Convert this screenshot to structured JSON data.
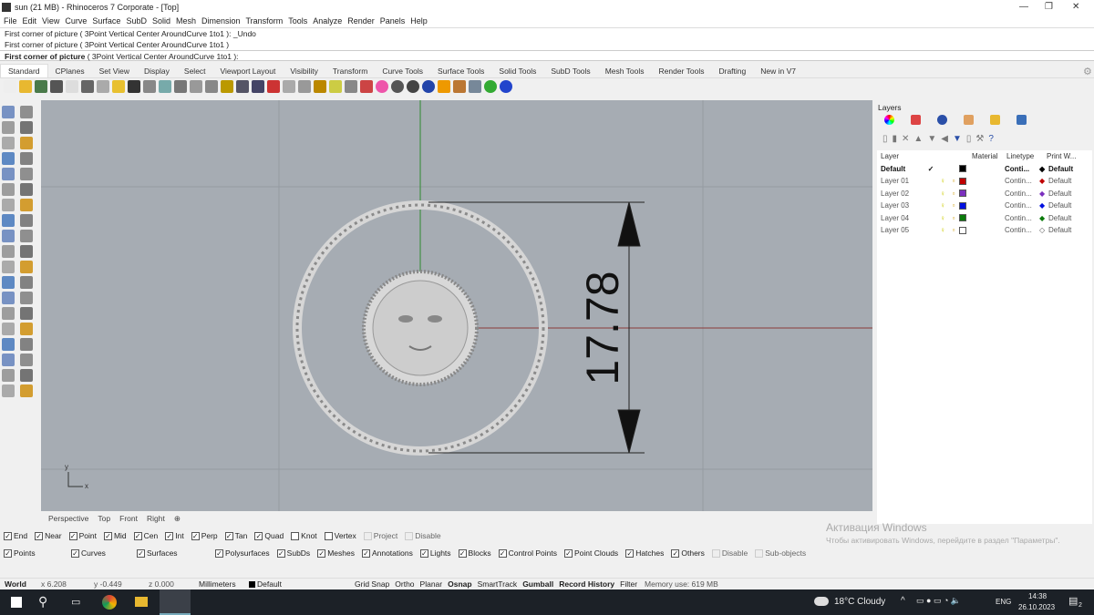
{
  "window": {
    "title": "sun (21 MB) - Rhinoceros 7 Corporate - [Top]"
  },
  "menu": [
    "File",
    "Edit",
    "View",
    "Curve",
    "Surface",
    "SubD",
    "Solid",
    "Mesh",
    "Dimension",
    "Transform",
    "Tools",
    "Analyze",
    "Render",
    "Panels",
    "Help"
  ],
  "command_history": [
    "First corner of picture ( 3Point  Vertical  Center  AroundCurve  1to1 ): _Undo",
    "First corner of picture ( 3Point  Vertical  Center  AroundCurve  1to1 )"
  ],
  "command_prompt": {
    "label": "First corner of picture",
    "options": "( 3Point  Vertical  Center  AroundCurve  1to1 ):"
  },
  "toolbar_tabs": [
    "Standard",
    "CPlanes",
    "Set View",
    "Display",
    "Select",
    "Viewport Layout",
    "Visibility",
    "Transform",
    "Curve Tools",
    "Surface Tools",
    "Solid Tools",
    "SubD Tools",
    "Mesh Tools",
    "Render Tools",
    "Drafting",
    "New in V7"
  ],
  "toolbar_icons": [
    "new-icon",
    "open-icon",
    "save-icon",
    "print-icon",
    "import-icon",
    "cut-icon",
    "copy-icon",
    "paste-icon",
    "undo-icon",
    "pan-icon",
    "rotate-view-icon",
    "zoom-icon",
    "zoom-window-icon",
    "zoom-extents-icon",
    "zoom-selected-icon",
    "undo-view-icon",
    "viewport-layout-icon",
    "car-icon",
    "hide-icon",
    "object-snap-icon",
    "point-icon",
    "light-icon",
    "lock-icon",
    "layer-icon",
    "color-wheel-icon",
    "shaded-icon",
    "rendered-icon",
    "sphere-render-icon",
    "filter-icon",
    "settings-gear-icon",
    "grid-icon",
    "globe-icon",
    "help-icon"
  ],
  "viewport": {
    "dimension_text": "17.78",
    "axis_y": "y",
    "axis_x": "x",
    "bg": "#a6acb3"
  },
  "viewport_tabs": [
    "Perspective",
    "Top",
    "Front",
    "Right"
  ],
  "layers": {
    "title": "Layers",
    "columns": [
      "Layer",
      "Material",
      "Linetype",
      "Print W..."
    ],
    "rows": [
      {
        "name": "Default",
        "linetype": "Conti...",
        "print": "Default",
        "color": "#000000",
        "current": true
      },
      {
        "name": "Layer 01",
        "linetype": "Contin...",
        "print": "Default",
        "color": "#c00000"
      },
      {
        "name": "Layer 02",
        "linetype": "Contin...",
        "print": "Default",
        "color": "#7b2fbe"
      },
      {
        "name": "Layer 03",
        "linetype": "Contin...",
        "print": "Default",
        "color": "#0010e0"
      },
      {
        "name": "Layer 04",
        "linetype": "Contin...",
        "print": "Default",
        "color": "#0a7a0a"
      },
      {
        "name": "Layer 05",
        "linetype": "Contin...",
        "print": "Default",
        "color": "#ffffff"
      }
    ]
  },
  "osnaps": [
    {
      "l": "End",
      "c": true
    },
    {
      "l": "Near",
      "c": true
    },
    {
      "l": "Point",
      "c": true
    },
    {
      "l": "Mid",
      "c": true
    },
    {
      "l": "Cen",
      "c": true
    },
    {
      "l": "Int",
      "c": true
    },
    {
      "l": "Perp",
      "c": true
    },
    {
      "l": "Tan",
      "c": true
    },
    {
      "l": "Quad",
      "c": true
    },
    {
      "l": "Knot",
      "c": false
    },
    {
      "l": "Vertex",
      "c": false
    },
    {
      "l": "Project",
      "c": false,
      "d": true
    },
    {
      "l": "Disable",
      "c": false,
      "d": true
    }
  ],
  "filters": [
    {
      "l": "Points",
      "c": true
    },
    {
      "l": "Curves",
      "c": true
    },
    {
      "l": "Surfaces",
      "c": true
    },
    {
      "l": "Polysurfaces",
      "c": true
    },
    {
      "l": "SubDs",
      "c": true
    },
    {
      "l": "Meshes",
      "c": true
    },
    {
      "l": "Annotations",
      "c": true
    },
    {
      "l": "Lights",
      "c": true
    },
    {
      "l": "Blocks",
      "c": true
    },
    {
      "l": "Control Points",
      "c": true
    },
    {
      "l": "Point Clouds",
      "c": true
    },
    {
      "l": "Hatches",
      "c": true
    },
    {
      "l": "Others",
      "c": true
    },
    {
      "l": "Disable",
      "c": false,
      "d": true
    },
    {
      "l": "Sub-objects",
      "c": false,
      "d": true
    }
  ],
  "activation": {
    "title": "Активация Windows",
    "text": "Чтобы активировать Windows, перейдите в раздел \"Параметры\"."
  },
  "status": {
    "cplane": "World",
    "x": "x 6.208",
    "y": "y -0.449",
    "z": "z 0.000",
    "units": "Millimeters",
    "layer": "Default",
    "toggles": [
      "Grid Snap",
      "Ortho",
      "Planar",
      "Osnap",
      "SmartTrack",
      "Gumball",
      "Record History",
      "Filter"
    ],
    "memory": "Memory use: 619 MB"
  },
  "taskbar": {
    "weather": "18°C  Cloudy",
    "lang": "ENG",
    "time": "14:38",
    "date": "26.10.2023",
    "notifications": "2"
  }
}
